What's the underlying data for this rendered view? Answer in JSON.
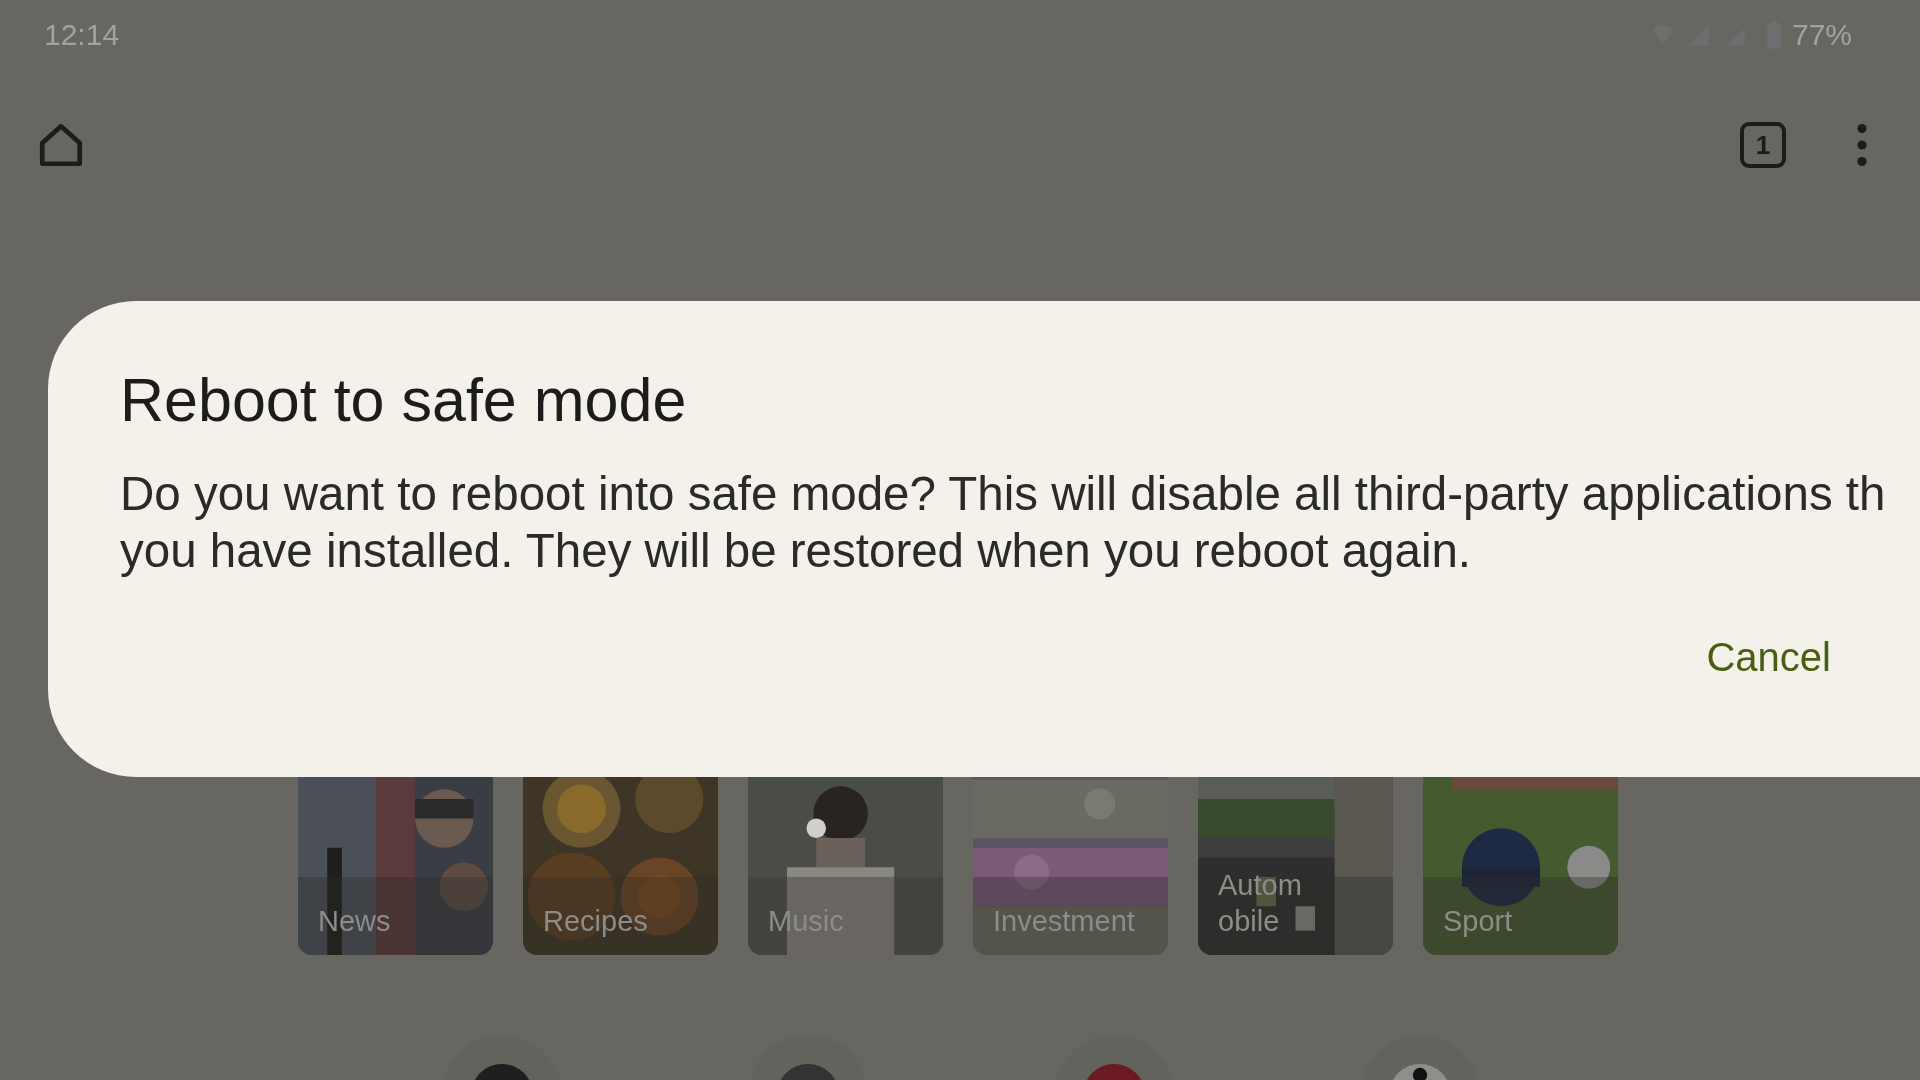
{
  "status_bar": {
    "time": "12:14",
    "battery": "77%"
  },
  "toolbar": {
    "tab_count": "1"
  },
  "dialog": {
    "title": "Reboot to safe mode",
    "body_lines": [
      "Do you want to reboot into safe mode? This will disable all third-party applications th",
      "you have installed. They will be restored when you reboot again."
    ],
    "buttons": [
      "Cancel"
    ]
  },
  "tiles": [
    {
      "label_lines": [
        "News"
      ]
    },
    {
      "label_lines": [
        "Recipes"
      ]
    },
    {
      "label_lines": [
        "Music"
      ]
    },
    {
      "label_lines": [
        "Investment"
      ]
    },
    {
      "label_lines": [
        "Autom",
        "obile"
      ]
    },
    {
      "label_lines": [
        "Sport"
      ]
    }
  ],
  "shortcuts": [
    {
      "color": "#1f1f1f",
      "kind": "plain"
    },
    {
      "color": "#333333",
      "kind": "plain"
    },
    {
      "color": "#6b1a22",
      "kind": "plain"
    },
    {
      "color": "#8e8f8b",
      "kind": "figure"
    }
  ]
}
